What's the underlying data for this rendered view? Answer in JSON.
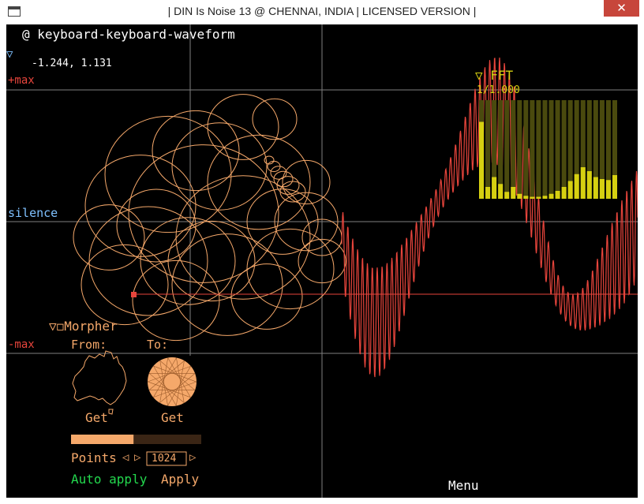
{
  "window": {
    "title": "| DIN Is Noise 13 @ CHENNAI, INDIA | LICENSED VERSION |",
    "close_glyph": "✕"
  },
  "header": {
    "waveform_name": "@ keyboard-keyboard-waveform",
    "collapse_glyph": "▽",
    "cursor_readout": "-1.244, 1.131"
  },
  "levels": {
    "max_label": "+max",
    "silence_label": "silence",
    "min_label": "-max"
  },
  "fft": {
    "title": "▽ FFT",
    "ratio": "1/1.000",
    "values": [
      0.78,
      0.12,
      0.22,
      0.15,
      0.07,
      0.12,
      0.05,
      0.03,
      0.02,
      0.02,
      0.03,
      0.05,
      0.08,
      0.12,
      0.18,
      0.25,
      0.32,
      0.28,
      0.22,
      0.2,
      0.19,
      0.24
    ]
  },
  "morpher": {
    "title": "▽◻Morpher",
    "from_label": "From:",
    "to_label": "To:",
    "get_from_label": "Get",
    "get_to_label": "Get",
    "progress": 0.48,
    "points_label": "Points",
    "arrow_left": "◁",
    "arrow_right": "▷",
    "points_value": "1024",
    "arrow_right_small": "▷",
    "auto_apply_label": "Auto apply",
    "apply_label": "Apply"
  },
  "menu_label": "Menu",
  "colors": {
    "orange": "#f5a86a",
    "red": "#e8453c",
    "grid": "#7f7f7f",
    "fft_bright": "#d6d011",
    "fft_dim": "#4a4a0e",
    "green": "#23d84e",
    "white": "#ffffff",
    "cyan": "#7fc1ff"
  }
}
